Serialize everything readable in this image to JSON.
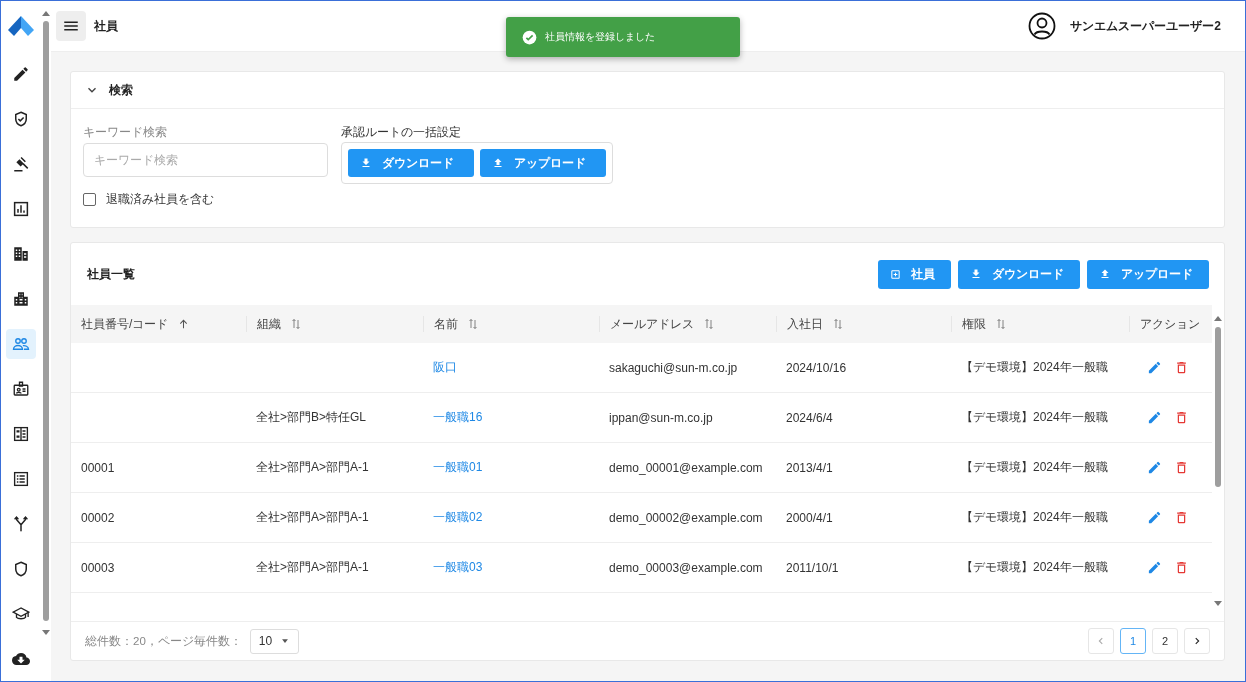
{
  "header": {
    "page_title": "社員",
    "user_name": "サンエムスーパーユーザー2"
  },
  "toast": {
    "message": "社員情報を登録しました"
  },
  "sidebar": {
    "items": [
      {
        "kind": "pencil",
        "selected": false
      },
      {
        "kind": "shield-check",
        "selected": false
      },
      {
        "kind": "gavel",
        "selected": false
      },
      {
        "kind": "chart",
        "selected": false
      },
      {
        "kind": "building",
        "selected": false
      },
      {
        "kind": "buildings",
        "selected": false
      },
      {
        "kind": "people",
        "selected": true
      },
      {
        "kind": "badge",
        "selected": false
      },
      {
        "kind": "card-list",
        "selected": false
      },
      {
        "kind": "list",
        "selected": false
      },
      {
        "kind": "fork",
        "selected": false
      },
      {
        "kind": "shield",
        "selected": false
      },
      {
        "kind": "cap",
        "selected": false
      },
      {
        "kind": "cloud-download",
        "selected": false
      }
    ]
  },
  "search": {
    "title": "検索",
    "expanded": true,
    "keyword": {
      "label": "キーワード検索",
      "placeholder": "キーワード検索"
    },
    "include_retired": {
      "label": "退職済み社員を含む",
      "checked": false
    },
    "bulk_route": {
      "label": "承認ルートの一括設定",
      "buttons": [
        {
          "kind": "download",
          "label": "ダウンロード"
        },
        {
          "kind": "upload",
          "label": "アップロード"
        }
      ]
    }
  },
  "list": {
    "title": "社員一覧",
    "buttons": [
      {
        "kind": "add",
        "label": "社員"
      },
      {
        "kind": "download",
        "label": "ダウンロード"
      },
      {
        "kind": "upload",
        "label": "アップロード"
      }
    ],
    "columns": [
      {
        "label": "社員番号/コード",
        "sorted": true
      },
      {
        "label": "組織",
        "sorted": false
      },
      {
        "label": "名前",
        "sorted": false
      },
      {
        "label": "メールアドレス",
        "sorted": false
      },
      {
        "label": "入社日",
        "sorted": false
      },
      {
        "label": "権限",
        "sorted": false
      },
      {
        "label": "アクション"
      }
    ],
    "rows": [
      {
        "name": "阪口",
        "email": "sakaguchi@sun-m.co.jp",
        "joined": "2024/10/16",
        "role": "【デモ環境】2024年一般職"
      },
      {
        "organization": "全社>部門B>特任GL",
        "name": "一般職16",
        "email": "ippan@sun-m.co.jp",
        "joined": "2024/6/4",
        "role": "【デモ環境】2024年一般職"
      },
      {
        "code": "00001",
        "organization": "全社>部門A>部門A-1",
        "name": "一般職01",
        "email": "demo_00001@example.com",
        "joined": "2013/4/1",
        "role": "【デモ環境】2024年一般職"
      },
      {
        "code": "00002",
        "organization": "全社>部門A>部門A-1",
        "name": "一般職02",
        "email": "demo_00002@example.com",
        "joined": "2000/4/1",
        "role": "【デモ環境】2024年一般職"
      },
      {
        "code": "00003",
        "organization": "全社>部門A>部門A-1",
        "name": "一般職03",
        "email": "demo_00003@example.com",
        "joined": "2011/10/1",
        "role": "【デモ環境】2024年一般職"
      }
    ],
    "pagination": {
      "summary": "総件数：20，ページ毎件数：",
      "page_size": "10",
      "pages": [
        {
          "label": "1",
          "selected": true
        },
        {
          "label": "2",
          "selected": false
        }
      ]
    }
  }
}
